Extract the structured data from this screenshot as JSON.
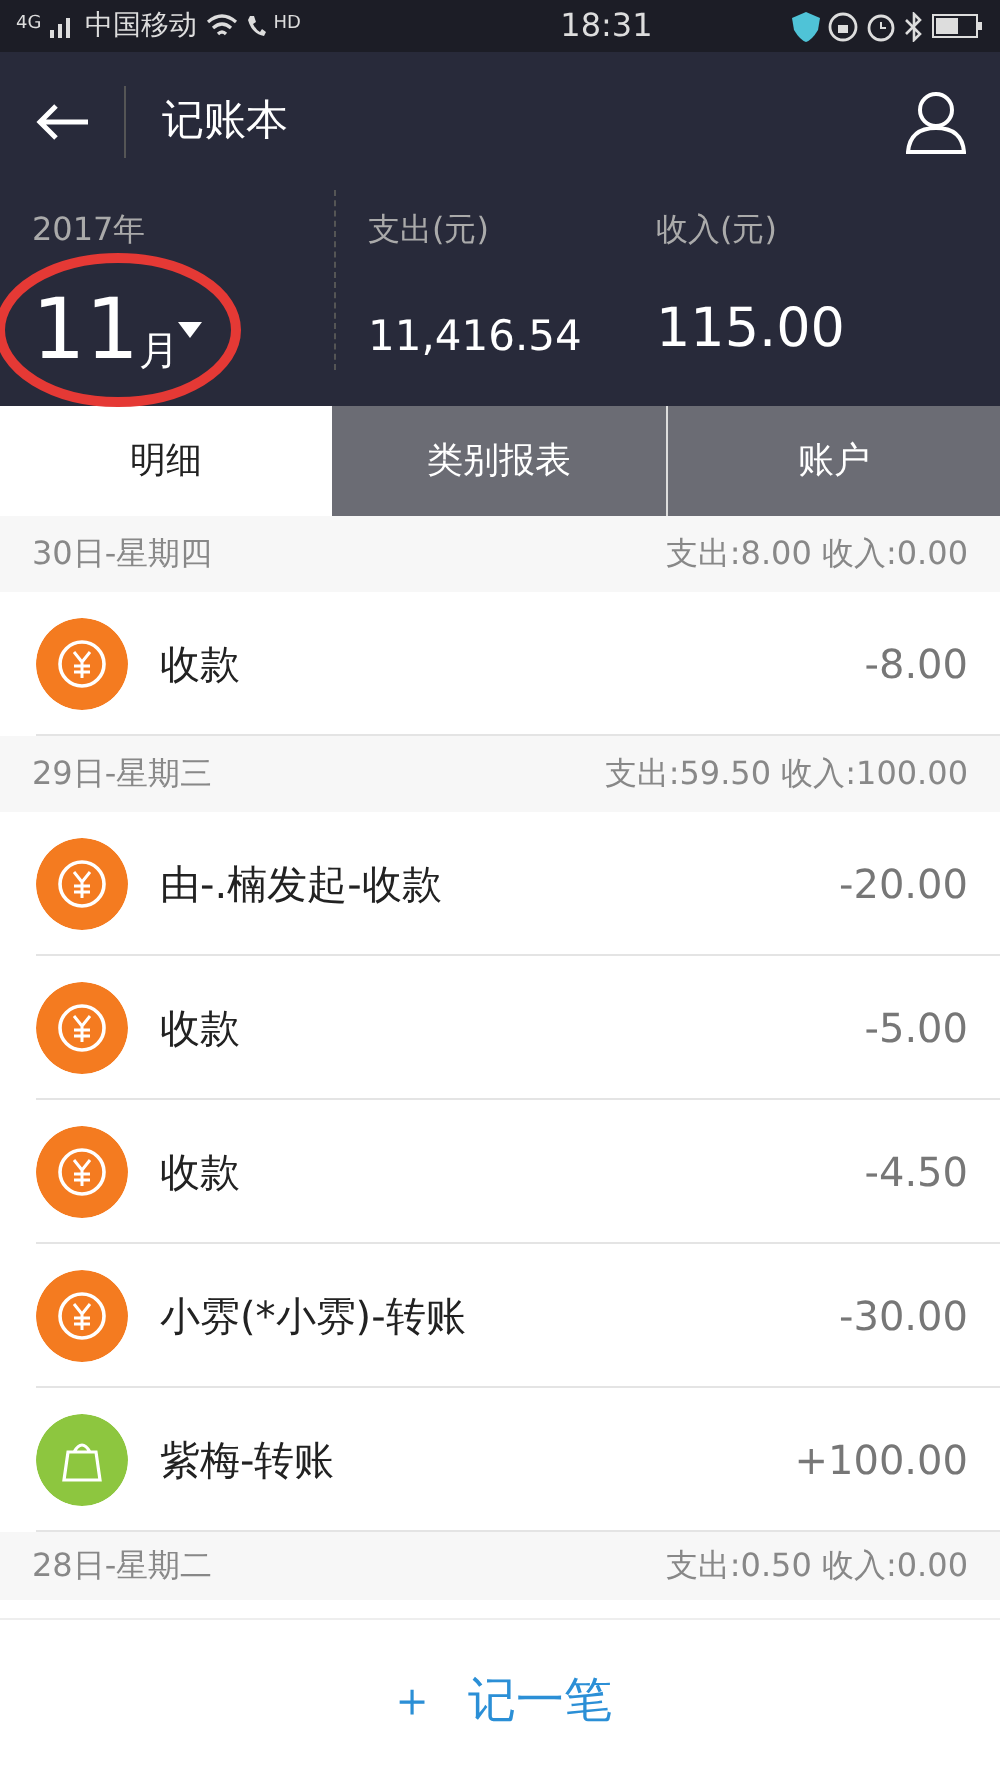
{
  "status_bar": {
    "network": "4G",
    "carrier": "中国移动",
    "hd": "HD",
    "time": "18:31"
  },
  "header": {
    "title": "记账本"
  },
  "summary": {
    "year": "2017年",
    "month": "11",
    "month_unit": "月",
    "expense_label": "支出(元)",
    "expense": "11,416.54",
    "income_label": "收入(元)",
    "income": "115.00"
  },
  "tabs": [
    {
      "label": "明细",
      "selected": true
    },
    {
      "label": "类别报表",
      "selected": false
    },
    {
      "label": "账户",
      "selected": false
    }
  ],
  "days": [
    {
      "date": "30日-星期四",
      "totals": "支出:8.00 收入:0.00",
      "entries": [
        {
          "kind": "expense",
          "color": "#f47b20",
          "name": "收款",
          "amount": "-8.00"
        }
      ]
    },
    {
      "date": "29日-星期三",
      "totals": "支出:59.50 收入:100.00",
      "entries": [
        {
          "kind": "expense",
          "color": "#f47b20",
          "name": "由-.楠发起-收款",
          "amount": "-20.00"
        },
        {
          "kind": "expense",
          "color": "#f47b20",
          "name": "收款",
          "amount": "-5.00"
        },
        {
          "kind": "expense",
          "color": "#f47b20",
          "name": "收款",
          "amount": "-4.50"
        },
        {
          "kind": "expense",
          "color": "#f47b20",
          "name": "小雰(*小雰)-转账",
          "amount": "-30.00"
        },
        {
          "kind": "income",
          "color": "#8dc63f",
          "name": "紫梅-转账",
          "amount": "+100.00"
        }
      ]
    },
    {
      "date": "28日-星期二",
      "totals": "支出:0.50 收入:0.00"
    }
  ],
  "add_button": {
    "icon": "＋",
    "label": "记一笔"
  }
}
